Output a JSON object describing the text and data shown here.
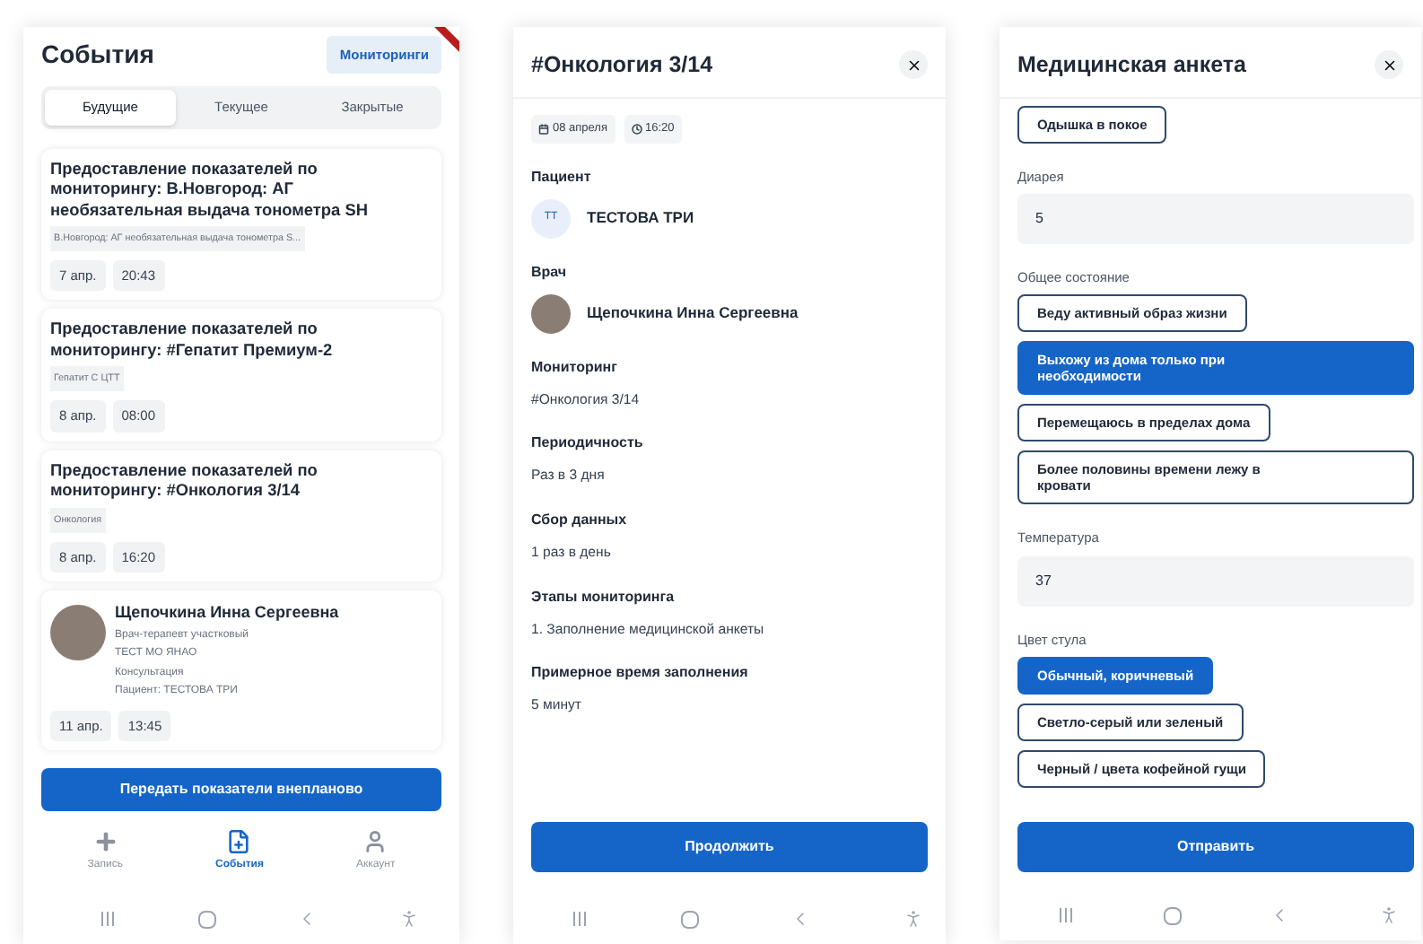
{
  "events_screen": {
    "title": "События",
    "monitoring_button": "Мониторинги",
    "tabs": [
      {
        "label": "Будущие",
        "selected": true
      },
      {
        "label": "Текущее",
        "selected": false
      },
      {
        "label": "Закрытые",
        "selected": false
      }
    ],
    "events": [
      {
        "kind": "monitoring",
        "title": "Предоставление показателей по мониторингу: В.Новгород: АГ необязательная выдача тонометра SH",
        "tag": "В.Новгород: АГ необязательная выдача тонометра S...",
        "date": "7 апр.",
        "time": "20:43"
      },
      {
        "kind": "monitoring",
        "title": "Предоставление показателей по мониторингу: #Гепатит Премиум-2",
        "tag": "Гепатит С ЦТТ",
        "date": "8 апр.",
        "time": "08:00"
      },
      {
        "kind": "monitoring",
        "title": "Предоставление показателей по мониторингу: #Онкология 3/14",
        "tag": "Онкология",
        "date": "8 апр.",
        "time": "16:20"
      },
      {
        "kind": "consultation",
        "name": "Щепочкина Инна Сергеевна",
        "lines": [
          "Врач-терапевт участковый",
          "ТЕСТ МО ЯНАО",
          "Консультация",
          "Пациент: ТЕСТОВА ТРИ"
        ],
        "date": "11 апр.",
        "time": "13:45"
      }
    ],
    "action_button": "Передать показатели внепланово",
    "nav": [
      {
        "label": "Запись",
        "selected": false
      },
      {
        "label": "События",
        "selected": true
      },
      {
        "label": "Аккаунт",
        "selected": false
      }
    ]
  },
  "detail_screen": {
    "title": "#Онкология 3/14",
    "date": "08 апреля",
    "time": "16:20",
    "sections": [
      {
        "kind": "patient",
        "label": "Пациент",
        "initials": "ТТ",
        "value": "ТЕСТОВА ТРИ"
      },
      {
        "kind": "doctor",
        "label": "Врач",
        "value": "Щепочкина Инна Сергеевна"
      },
      {
        "kind": "text",
        "label": "Мониторинг",
        "value": "#Онкология 3/14"
      },
      {
        "kind": "text",
        "label": "Периодичность",
        "value": "Раз в 3 дня"
      },
      {
        "kind": "text",
        "label": "Сбор данных",
        "value": "1 раз в день"
      },
      {
        "kind": "text",
        "label": "Этапы мониторинга",
        "value": "1. Заполнение медицинской анкеты"
      },
      {
        "kind": "text",
        "label": "Примерное время заполнения",
        "value": "5 минут"
      }
    ],
    "button": "Продолжить"
  },
  "form_screen": {
    "title": "Медицинская анкета",
    "fields": [
      {
        "kind": "options",
        "options": [
          {
            "label": "Одышка в покое",
            "selected": false
          }
        ]
      },
      {
        "kind": "input",
        "label": "Диарея",
        "value": "5"
      },
      {
        "kind": "options",
        "label": "Общее состояние",
        "options": [
          {
            "label": "Веду активный образ жизни",
            "selected": false
          },
          {
            "label": "Выхожу из дома только при необходимости",
            "selected": true
          },
          {
            "label": "Перемещаюсь в пределах дома",
            "selected": false
          },
          {
            "label": "Более половины времени лежу в кровати",
            "selected": false
          }
        ]
      },
      {
        "kind": "input",
        "label": "Температура",
        "value": "37"
      },
      {
        "kind": "options",
        "label": "Цвет стула",
        "options": [
          {
            "label": "Обычный, коричневый",
            "selected": true
          },
          {
            "label": "Светло-серый или зеленый",
            "selected": false
          },
          {
            "label": "Черный / цвета кофейной гущи",
            "selected": false
          }
        ]
      }
    ],
    "button": "Отправить"
  }
}
